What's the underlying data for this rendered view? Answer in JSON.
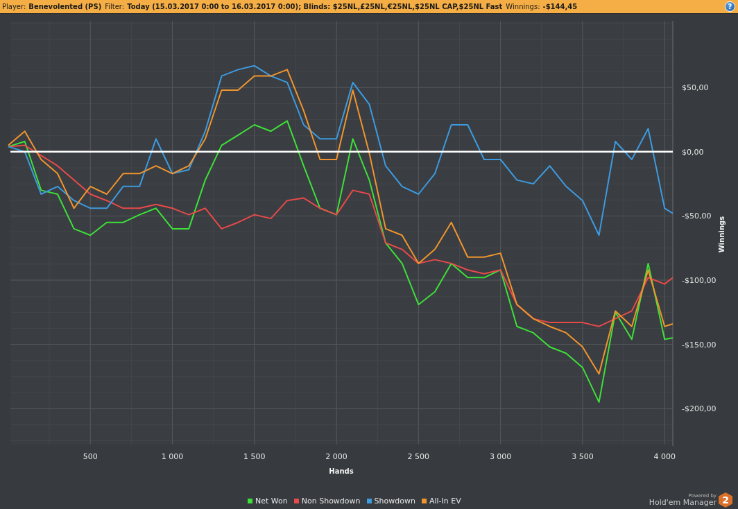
{
  "header": {
    "fields": [
      {
        "label": "Player:",
        "value": "Benevolented (PS)"
      },
      {
        "label": "Filter:",
        "value": "Today (15.03.2017 0:00 to 16.03.2017 0:00); Blinds: $25NL,£25NL,€25NL,$25NL CAP,$25NL Fast"
      },
      {
        "label": "Winnings:",
        "value": "-$144,45"
      }
    ],
    "help_button": "?"
  },
  "chart_data": {
    "type": "line",
    "xlabel": "Hands",
    "ylabel": "Winnings",
    "x": [
      0,
      100,
      200,
      300,
      400,
      500,
      600,
      700,
      800,
      900,
      1000,
      1100,
      1200,
      1300,
      1400,
      1500,
      1600,
      1700,
      1800,
      1900,
      2000,
      2100,
      2200,
      2300,
      2400,
      2500,
      2600,
      2700,
      2800,
      2900,
      3000,
      3100,
      3200,
      3300,
      3400,
      3500,
      3600,
      3700,
      3800,
      3900,
      4000,
      4050
    ],
    "series": [
      {
        "name": "Net Won",
        "color": "#3ee03a",
        "values": [
          4,
          8,
          -30,
          -33,
          -60,
          -65,
          -55,
          -55,
          -49,
          -44,
          -60,
          -60,
          -22,
          5,
          13,
          21,
          16,
          24,
          -11,
          -44,
          -49,
          10,
          -22,
          -71,
          -87,
          -119,
          -109,
          -87,
          -98,
          -98,
          -92,
          -136,
          -141,
          -152,
          -157,
          -168,
          -195,
          -125,
          -146,
          -87,
          -146,
          -145
        ]
      },
      {
        "name": "Non Showdown",
        "color": "#e84a4a",
        "values": [
          4,
          5,
          -3,
          -11,
          -22,
          -33,
          -38,
          -44,
          -44,
          -41,
          -44,
          -49,
          -44,
          -60,
          -55,
          -49,
          -52,
          -38,
          -36,
          -44,
          -49,
          -30,
          -33,
          -71,
          -76,
          -87,
          -84,
          -87,
          -92,
          -95,
          -92,
          -119,
          -130,
          -133,
          -133,
          -133,
          -136,
          -130,
          -124,
          -98,
          -103,
          -98
        ]
      },
      {
        "name": "Showdown",
        "color": "#3d9be0",
        "values": [
          4,
          0,
          -33,
          -27,
          -38,
          -44,
          -44,
          -27,
          -27,
          10,
          -17,
          -14,
          16,
          59,
          64,
          67,
          59,
          54,
          21,
          10,
          10,
          54,
          37,
          -11,
          -27,
          -33,
          -17,
          21,
          21,
          -6,
          -6,
          -22,
          -25,
          -11,
          -27,
          -38,
          -65,
          8,
          -6,
          18,
          -44,
          -48
        ]
      },
      {
        "name": "All-In EV",
        "color": "#f0952e",
        "values": [
          5,
          16,
          -6,
          -17,
          -44,
          -27,
          -33,
          -17,
          -17,
          -11,
          -17,
          -11,
          10,
          48,
          48,
          59,
          59,
          64,
          32,
          -6,
          -6,
          48,
          -1,
          -60,
          -65,
          -87,
          -76,
          -55,
          -82,
          -82,
          -79,
          -119,
          -130,
          -136,
          -141,
          -152,
          -173,
          -124,
          -136,
          -92,
          -136,
          -134
        ]
      }
    ],
    "xlim": [
      0,
      4050
    ],
    "ylim": [
      -228,
      102
    ],
    "xticks": [
      {
        "value": 500,
        "label": "500"
      },
      {
        "value": 1000,
        "label": "1 000"
      },
      {
        "value": 1500,
        "label": "1 500"
      },
      {
        "value": 2000,
        "label": "2 000"
      },
      {
        "value": 2500,
        "label": "2 500"
      },
      {
        "value": 3000,
        "label": "3 000"
      },
      {
        "value": 3500,
        "label": "3 500"
      },
      {
        "value": 4000,
        "label": "4 000"
      }
    ],
    "yticks": [
      {
        "value": 50,
        "label": "$50,00"
      },
      {
        "value": 0,
        "label": "$0,00"
      },
      {
        "value": -50,
        "label": "-$50,00"
      },
      {
        "value": -100,
        "label": "-$100,00"
      },
      {
        "value": -150,
        "label": "-$150,00"
      },
      {
        "value": -200,
        "label": "-$200,00"
      }
    ],
    "grid": true,
    "ref_lines": [
      {
        "axis": "y",
        "value": 0
      }
    ]
  },
  "branding": {
    "powered_by": "Powered by",
    "product": "Hold'em Manager",
    "version": "2"
  }
}
